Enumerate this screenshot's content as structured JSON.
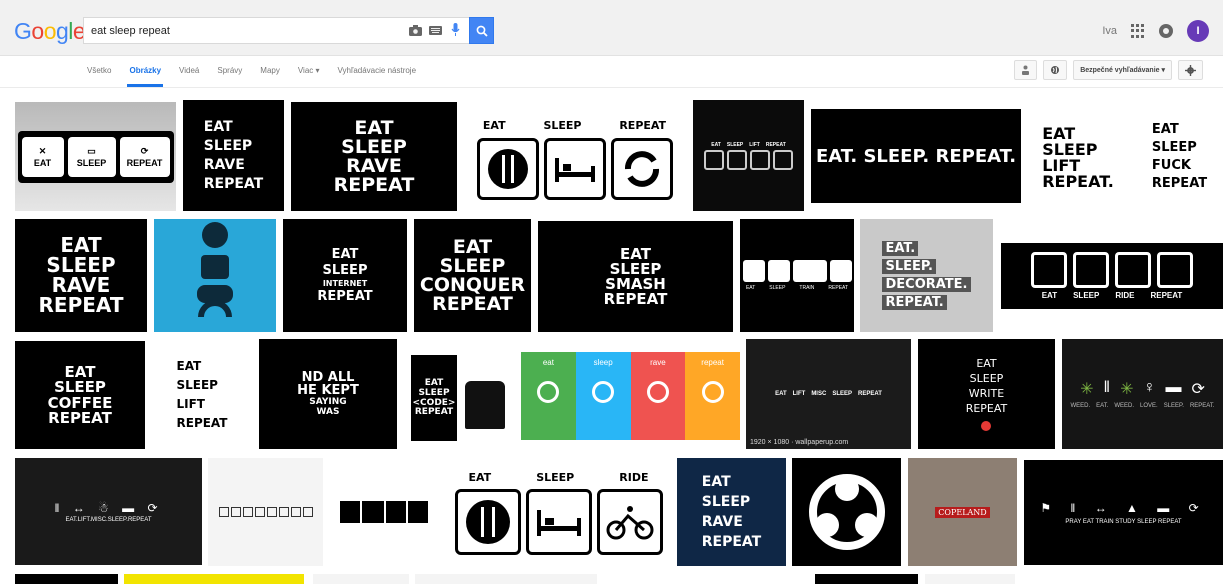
{
  "logo": {
    "letters": [
      {
        "ch": "G",
        "color": "#4285f4"
      },
      {
        "ch": "o",
        "color": "#ea4335"
      },
      {
        "ch": "o",
        "color": "#fbbc05"
      },
      {
        "ch": "g",
        "color": "#4285f4"
      },
      {
        "ch": "l",
        "color": "#34a853"
      },
      {
        "ch": "e",
        "color": "#ea4335"
      }
    ]
  },
  "search": {
    "value": "eat sleep repeat",
    "icons": [
      "camera-icon",
      "keyboard-icon",
      "mic-icon",
      "search-icon"
    ]
  },
  "user": {
    "name": "Iva",
    "avatar_letter": "I",
    "avatar_color": "#673ab7"
  },
  "tabs": [
    {
      "label": "Všetko",
      "active": false
    },
    {
      "label": "Obrázky",
      "active": true
    },
    {
      "label": "Videá",
      "active": false
    },
    {
      "label": "Správy",
      "active": false
    },
    {
      "label": "Mapy",
      "active": false
    },
    {
      "label": "Viac ▾",
      "active": false
    },
    {
      "label": "Vyhľadávacie nástroje",
      "active": false
    }
  ],
  "tools": {
    "safe_search": "Bezpečné vyhľadávanie ▾"
  },
  "images": {
    "r1": {
      "a": [
        "EAT",
        "SLEEP",
        "REPEAT"
      ],
      "b": [
        "EAT",
        "SLEEP",
        "RAVE",
        "REPEAT"
      ],
      "c": [
        "EAT",
        "SLEEP",
        "RAVE",
        "REPEAT"
      ],
      "d": [
        "EAT",
        "SLEEP",
        "REPEAT"
      ],
      "e": [
        "EAT",
        "SLEEP",
        "LIFT",
        "REPEAT"
      ],
      "f": "EAT. SLEEP. REPEAT.",
      "g": [
        "EAT",
        "SLEEP",
        "LIFT",
        "REPEAT."
      ],
      "h": [
        "EAT",
        "SLEEP",
        "FUCK",
        "REPEAT"
      ]
    },
    "r2": {
      "a": [
        "EAT",
        "SLEEP",
        "RAVE",
        "REPEAT"
      ],
      "c": [
        "EAT",
        "SLEEP",
        "INTERNET",
        "REPEAT"
      ],
      "d": [
        "EAT",
        "SLEEP",
        "CONQUER",
        "REPEAT"
      ],
      "e": [
        "EAT",
        "SLEEP",
        "SMASH",
        "REPEAT"
      ],
      "f": [
        "EAT",
        "SLEEP",
        "TRAIN",
        "REPEAT"
      ],
      "g": [
        "EAT.",
        "SLEEP.",
        "DECORATE.",
        "REPEAT."
      ],
      "h": [
        "EAT",
        "SLEEP",
        "RIDE",
        "REPEAT"
      ]
    },
    "r3": {
      "a": [
        "EAT",
        "SLEEP",
        "COFFEE",
        "REPEAT"
      ],
      "b": [
        "EAT",
        "SLEEP",
        "LIFT",
        "REPEAT"
      ],
      "c": [
        "ND ALL",
        "HE KEPT",
        "SAYING",
        "WAS"
      ],
      "d": [
        "EAT",
        "SLEEP",
        "<CODE>",
        "REPEAT"
      ],
      "e": [
        {
          "label": "eat",
          "color": "#4caf50"
        },
        {
          "label": "sleep",
          "color": "#29b6f6"
        },
        {
          "label": "rave",
          "color": "#ef5350"
        },
        {
          "label": "repeat",
          "color": "#ffa726"
        }
      ],
      "f": [
        "EAT",
        "LIFT",
        "MISC",
        "SLEEP",
        "REPEAT"
      ],
      "f_caption": "1920 × 1080 · wallpaperup.com",
      "g": [
        "EAT",
        "SLEEP",
        "WRITE",
        "REPEAT"
      ],
      "h": [
        "WEED.",
        "EAT.",
        "WEED.",
        "LOVE.",
        "SLEEP.",
        "REPEAT."
      ]
    },
    "r4": {
      "a": "EAT.LIFT.MISC.SLEEP.REPEAT",
      "d": [
        "EAT",
        "SLEEP",
        "RIDE"
      ],
      "e": [
        "EAT",
        "SLEEP",
        "RAVE",
        "REPEAT"
      ],
      "g": "COPELAND",
      "h": "PRAY EAT TRAIN STUDY SLEEP REPEAT"
    }
  }
}
